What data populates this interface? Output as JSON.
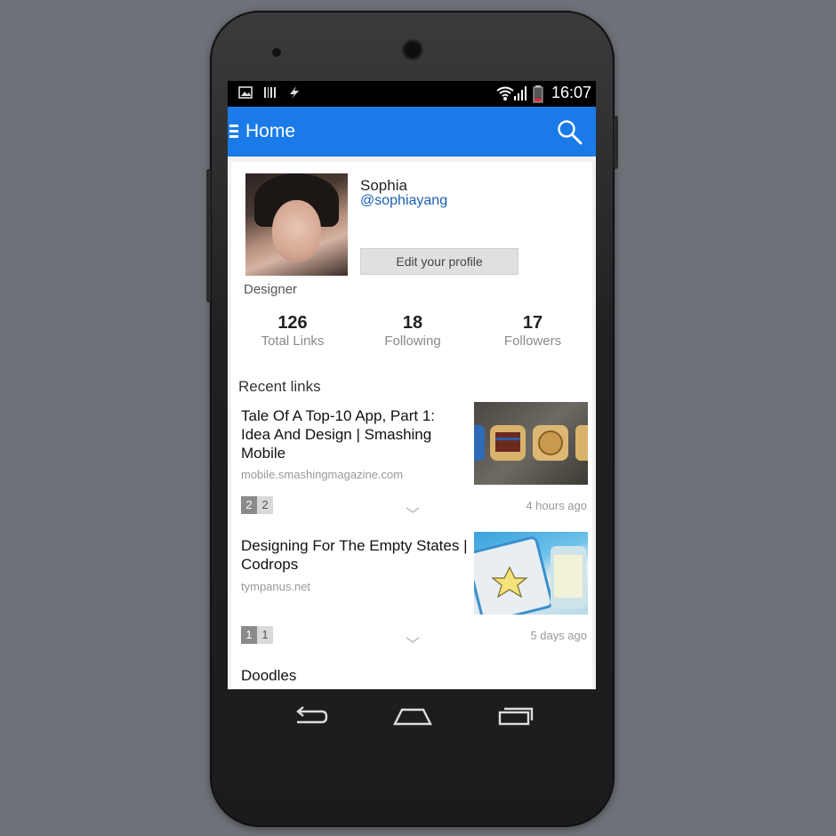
{
  "status_bar": {
    "time": "16:07",
    "left_icons": [
      "image-icon",
      "barcode-icon",
      "lightning-icon"
    ],
    "right_icons": [
      "wifi-icon",
      "signal-icon",
      "battery-icon"
    ]
  },
  "app_bar": {
    "title": "Home",
    "menu_icon": "hamburger-menu-icon",
    "search_icon": "search-icon",
    "color": "#1a7be8"
  },
  "profile": {
    "name": "Sophia",
    "handle": "@sophiayang",
    "edit_button": "Edit your profile",
    "role": "Designer"
  },
  "stats": [
    {
      "value": "126",
      "label": "Total Links"
    },
    {
      "value": "18",
      "label": "Following"
    },
    {
      "value": "17",
      "label": "Followers"
    }
  ],
  "recent": {
    "title": "Recent links",
    "items": [
      {
        "title": "Tale Of A Top-10 App, Part 1: Idea And Design | Smashing Mobile",
        "domain": "mobile.smashingmagazine.com",
        "count_a": "2",
        "count_b": "2",
        "time": "4 hours ago"
      },
      {
        "title": "Designing For The Empty States | Codrops",
        "domain": "tympanus.net",
        "count_a": "1",
        "count_b": "1",
        "time": "5 days ago"
      },
      {
        "title": "Doodles"
      }
    ]
  },
  "nav": {
    "back_icon": "back-icon",
    "home_icon": "home-icon",
    "recents_icon": "recent-apps-icon"
  }
}
